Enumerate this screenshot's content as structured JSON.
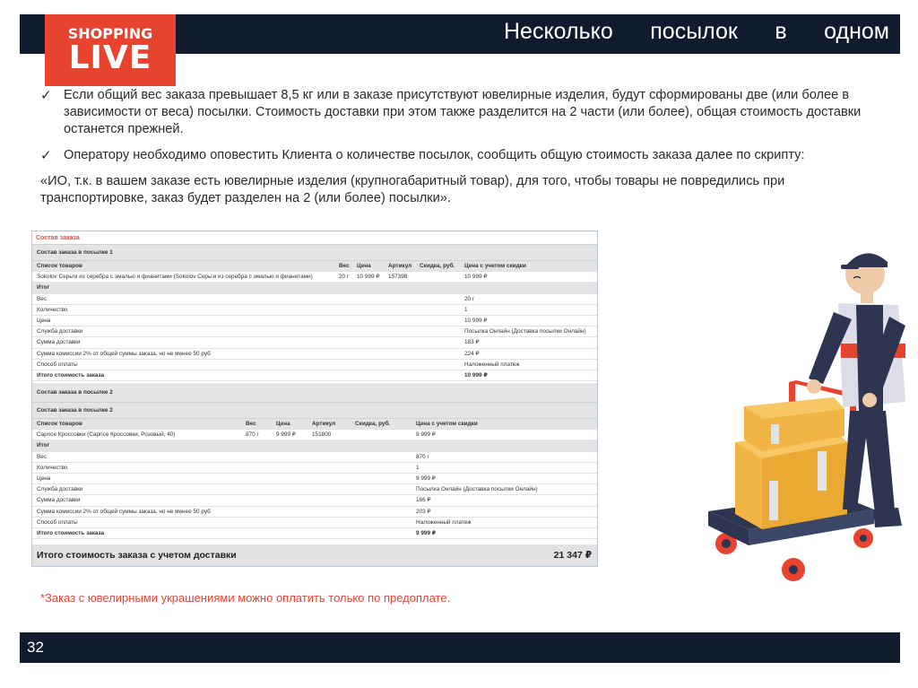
{
  "header": {
    "title_words": [
      "Несколько",
      "посылок",
      "в",
      "одном"
    ]
  },
  "logo": {
    "top": "SHOPPING",
    "bottom": "LIVE"
  },
  "bullets": [
    {
      "mark": "✓",
      "text": "Если общий вес заказа превышает 8,5 кг или в заказе присутствуют ювелирные изделия, будут сформированы две (или более в зависимости от веса) посылки. Стоимость доставки при этом также разделится на 2 части (или более), общая стоимость доставки останется прежней."
    },
    {
      "mark": "✓",
      "text": "Оператору необходимо оповестить Клиента о количестве посылок, сообщить общую стоимость заказа далее по скрипту:"
    }
  ],
  "quote": "«ИО, т.к. в вашем заказе есть ювелирные изделия (крупногабаритный товар), для того, чтобы товары не повредились при транспортировке, заказ будет разделен на 2 (или более) посылки».",
  "order": {
    "title": "Состав заказа",
    "parcel1": {
      "section": "Состав заказа в посылке 1",
      "headers": {
        "list": "Список товаров",
        "weight": "Вес",
        "price": "Цена",
        "article": "Артикул",
        "discount": "Скидка, руб.",
        "final": "Цена с учетом скидки"
      },
      "item": {
        "name": "Sokolov Серьги из серебра с эмалью и фианитами (Sokolov Серьги из серебра с эмалью и фианитами)",
        "weight": "20 г",
        "price": "10 999 ₽",
        "article": "157398",
        "discount": "",
        "final": "10 999 ₽"
      },
      "summary_label": "Итог",
      "summary": [
        {
          "label": "Вес",
          "value": "20 г"
        },
        {
          "label": "Количество",
          "value": "1"
        },
        {
          "label": "Цена",
          "value": "10 999 ₽"
        },
        {
          "label": "Служба доставки",
          "value": "Посылка Онлайн (Доставка посылки Онлайн)"
        },
        {
          "label": "Сумма доставки",
          "value": "183 ₽"
        },
        {
          "label": "Сумма комиссии 2% от общей суммы заказа, но не менее 50 руб",
          "value": "224 ₽"
        },
        {
          "label": "Способ оплаты",
          "value": "Наложенный платеж"
        }
      ],
      "total": {
        "label": "Итого стоимость заказа",
        "value": "10 999 ₽"
      }
    },
    "parcel2": {
      "section": "Состав заказа в посылке 2",
      "headers": {
        "list": "Список товаров",
        "weight": "Вес",
        "price": "Цена",
        "article": "Артикул",
        "discount": "Скидка, руб.",
        "final": "Цена с учетом скидки"
      },
      "item": {
        "name": "Caprice Кроссовки (Caprice Кроссовки, Розовый, 40)",
        "weight": "870 г",
        "price": "9 999 ₽",
        "article": "151800",
        "discount": "",
        "final": "9 999 ₽"
      },
      "summary_label": "Итог",
      "summary": [
        {
          "label": "Вес",
          "value": "870 г"
        },
        {
          "label": "Количество",
          "value": "1"
        },
        {
          "label": "Цена",
          "value": "9 999 ₽"
        },
        {
          "label": "Служба доставки",
          "value": "Посылка Онлайн (Доставка посылки Онлайн)"
        },
        {
          "label": "Сумма доставки",
          "value": "166 ₽"
        },
        {
          "label": "Сумма комиссии 2% от общей суммы заказа, но не менее 50 руб",
          "value": "203 ₽"
        },
        {
          "label": "Способ оплаты",
          "value": "Наложенный платеж"
        }
      ],
      "total": {
        "label": "Итого стоимость заказа",
        "value": "9 999 ₽"
      }
    },
    "grand_total": {
      "label": "Итого стоимость заказа с учетом доставки",
      "value": "21 347 ₽"
    }
  },
  "footnote": "*Заказ с ювелирными украшениями можно оплатить только по предоплате.",
  "page_number": "32",
  "colors": {
    "brand_red": "#e8432f",
    "navy": "#101c2e",
    "box_orange": "#f2b545",
    "cart_navy": "#2d3550"
  },
  "icons": [
    "check-icon",
    "delivery-person-illustration"
  ]
}
